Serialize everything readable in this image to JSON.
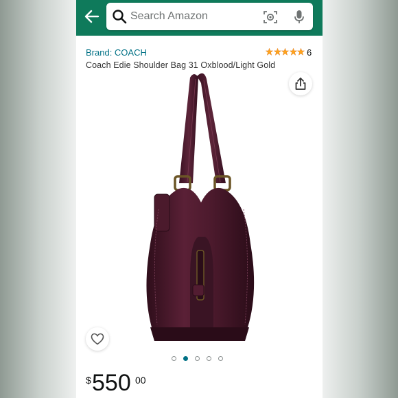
{
  "search": {
    "placeholder": "Search Amazon"
  },
  "product": {
    "brand": "Brand: COACH",
    "rating_count": "6",
    "rating": 5,
    "title": "Coach Edie Shoulder Bag 31 Oxblood/Light Gold"
  },
  "gallery": {
    "image_count": 5,
    "active_index": 1
  },
  "price": {
    "currency": "$",
    "whole": "550",
    "fraction": "00"
  },
  "colors": {
    "header": "#0f7a5b",
    "link": "#007185",
    "star": "#ffa41c",
    "bag": "#4e1a2e"
  },
  "icons": [
    "back-arrow-icon",
    "search-icon",
    "camera-lens-icon",
    "microphone-icon",
    "share-icon",
    "heart-icon"
  ]
}
